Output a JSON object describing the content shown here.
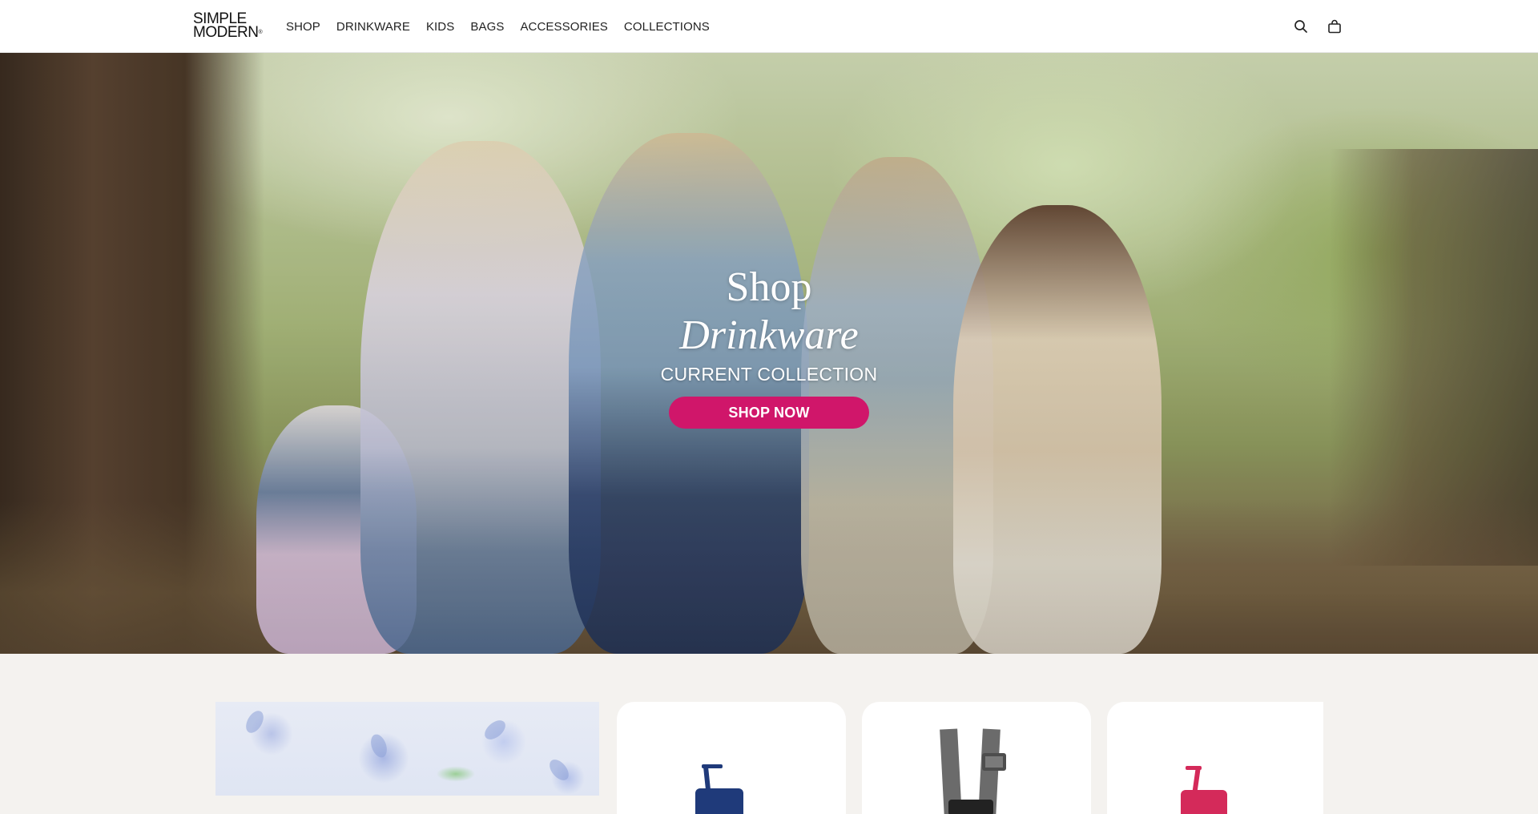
{
  "brand": {
    "logo_line1": "SIMPLE",
    "logo_line2": "MODERN",
    "logo_mark": "®"
  },
  "nav": {
    "items": [
      {
        "label": "SHOP"
      },
      {
        "label": "DRINKWARE"
      },
      {
        "label": "KIDS"
      },
      {
        "label": "BAGS"
      },
      {
        "label": "ACCESSORIES"
      },
      {
        "label": "COLLECTIONS"
      }
    ],
    "icons": {
      "search": "search-icon",
      "cart": "shopping-bag-icon"
    }
  },
  "hero": {
    "title": "Shop",
    "subtitle": "Drinkware",
    "eyebrow": "CURRENT COLLECTION",
    "cta_label": "SHOP NOW",
    "cta_color": "#d0166a"
  },
  "products": {
    "cards": [
      {
        "product": "navy tumbler with straw",
        "color": "#1f3a7a"
      },
      {
        "product": "grey strap bag",
        "color": "#6b6b6b"
      },
      {
        "product": "pink tumbler with straw",
        "color": "#d42a5a"
      }
    ]
  },
  "colors": {
    "header_bg": "#ffffff",
    "page_bg": "#f4f2ef",
    "text": "#222222",
    "accent": "#d0166a"
  }
}
